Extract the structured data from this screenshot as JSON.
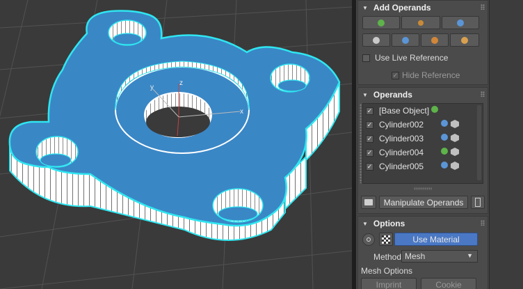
{
  "add_operands": {
    "title": "Add Operands",
    "row1_icons": [
      "union-icon",
      "intersect-icon",
      "subtract-icon"
    ],
    "row2_icons": [
      "merge-icon",
      "attach-icon",
      "insert-icon",
      "split-icon"
    ],
    "use_live_reference": "Use Live Reference",
    "hide_reference": "Hide Reference"
  },
  "operands": {
    "title": "Operands",
    "items": [
      {
        "name": "[Base Object]",
        "op": "union-icon"
      },
      {
        "name": "Cylinder002",
        "op": "subtract-icon"
      },
      {
        "name": "Cylinder003",
        "op": "subtract-icon"
      },
      {
        "name": "Cylinder004",
        "op": "union-icon"
      },
      {
        "name": "Cylinder005",
        "op": "subtract-icon"
      }
    ],
    "manipulate_label": "Manipulate Operands"
  },
  "options": {
    "title": "Options",
    "use_material": "Use Material",
    "method_label": "Method",
    "method_value": "Mesh",
    "mesh_options_label": "Mesh Options",
    "imprint_label": "Imprint",
    "cookie_label": "Cookie"
  },
  "viewport": {
    "axis_y": "y",
    "axis_z": "z",
    "axis_x": "x"
  },
  "colors": {
    "object_blue": "#3a87c6",
    "outline_cyan": "#2fe6f0",
    "selected_blue": "#4a78c4",
    "union_green": "#5eb34a",
    "subtract_blue": "#5b95d6"
  }
}
